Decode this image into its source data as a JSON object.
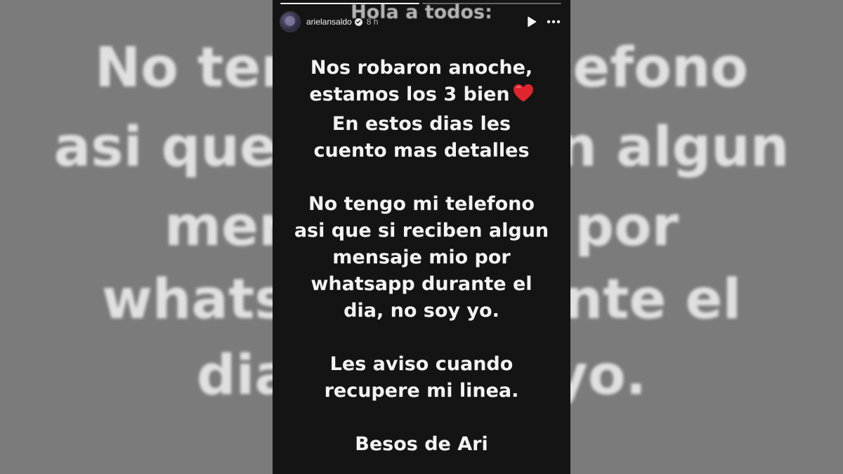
{
  "background": {
    "small_title": "Hola a todos:",
    "lines": [
      "No tengo mi telefono",
      "asi que si reciben algun",
      "mensaje mio por",
      "whatsapp durante el",
      "dia, no soy yo."
    ]
  },
  "story": {
    "progress_segments": 2,
    "progress_current": 1,
    "username": "arielansaldo",
    "time": "8 h",
    "overlay_title": "Hola a todos:",
    "icons": {
      "verified": "verified-badge-icon",
      "play": "play-icon",
      "more": "more-options-icon",
      "heart": "red-heart-emoji"
    },
    "paragraphs": [
      {
        "lines": [
          "Nos robaron anoche,",
          "estamos los 3 bien",
          "En estos dias les",
          "cuento mas detalles"
        ]
      },
      {
        "lines": [
          "No tengo mi telefono",
          "asi que si reciben algun",
          "mensaje mio por",
          "whatsapp durante el",
          "dia, no soy yo."
        ]
      },
      {
        "lines": [
          "Les aviso cuando",
          "recupere mi linea."
        ]
      },
      {
        "lines": [
          "Besos de Ari"
        ]
      }
    ]
  },
  "colors": {
    "panel_bg": "#141414",
    "text": "#f3f3f3",
    "heart": "#e0252f",
    "page_bg": "#7b7b7b"
  }
}
